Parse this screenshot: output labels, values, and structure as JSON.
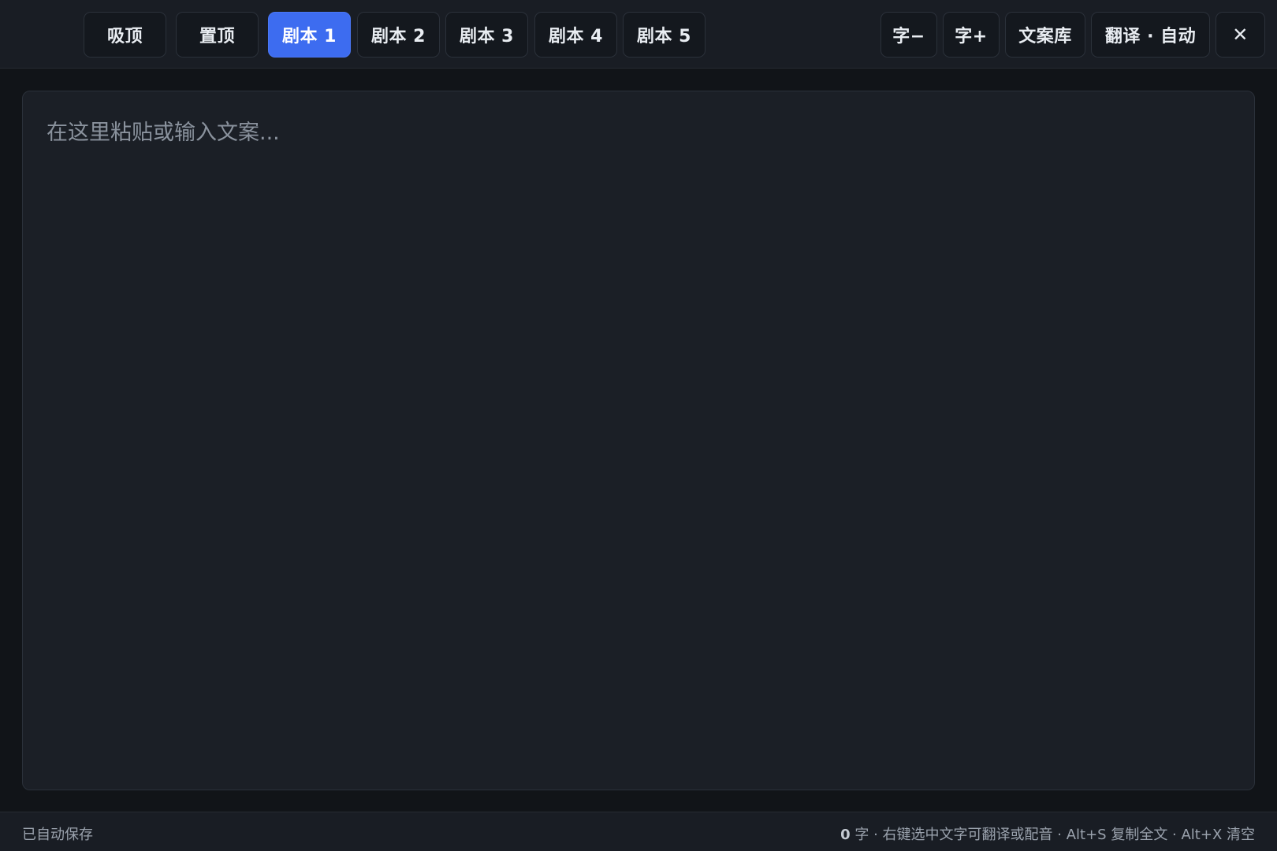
{
  "toolbar": {
    "left_buttons": {
      "snap_top": "吸顶",
      "pin_top": "置顶"
    },
    "tabs": [
      "剧本 1",
      "剧本 2",
      "剧本 3",
      "剧本 4",
      "剧本 5"
    ],
    "active_tab_index": 0,
    "right_buttons": {
      "font_smaller": "字−",
      "font_larger": "字+",
      "library": "文案库",
      "translate": "翻译 · 自动",
      "close": "✕"
    }
  },
  "editor": {
    "placeholder": "在这里粘贴或输入文案...",
    "value": ""
  },
  "status": {
    "save_state": "已自动保存",
    "char_count": "0",
    "char_unit": "字",
    "hints": " · 右键选中文字可翻译或配音 · Alt+S 复制全文 · Alt+X 清空"
  },
  "colors": {
    "accent": "#3d6cf0",
    "background": "#111418",
    "panel": "#1b1f26"
  }
}
